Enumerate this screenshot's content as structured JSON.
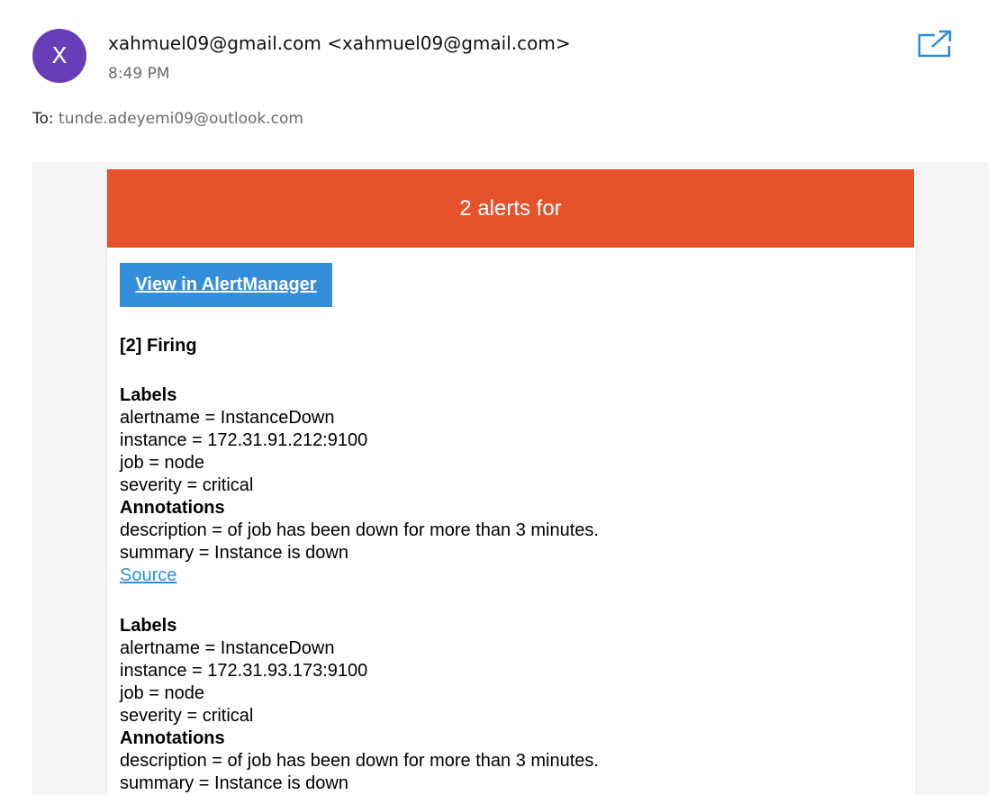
{
  "email": {
    "avatar_letter": "X",
    "avatar_color": "#6a3db8",
    "sender": "xahmuel09@gmail.com <xahmuel09@gmail.com>",
    "time": "8:49 PM",
    "to_label": "To:",
    "to_address": "tunde.adeyemi09@outlook.com",
    "popout_icon": "popout-icon"
  },
  "message": {
    "banner_text": "2 alerts for",
    "banner_color": "#e6522c",
    "view_button_label": "View in AlertManager",
    "view_button_color": "#348eda",
    "firing_heading": "[2] Firing",
    "alerts": [
      {
        "labels_heading": "Labels",
        "alertname": "alertname = InstanceDown",
        "instance": "instance = 172.31.91.212:9100",
        "job": "job = node",
        "severity": "severity = critical",
        "annotations_heading": "Annotations",
        "description": "description = of job has been down for more than 3 minutes.",
        "summary": "summary = Instance is down",
        "source_link": "Source"
      },
      {
        "labels_heading": "Labels",
        "alertname": "alertname = InstanceDown",
        "instance": "instance = 172.31.93.173:9100",
        "job": "job = node",
        "severity": "severity = critical",
        "annotations_heading": "Annotations",
        "description": "description = of job has been down for more than 3 minutes.",
        "summary": "summary = Instance is down"
      }
    ]
  }
}
